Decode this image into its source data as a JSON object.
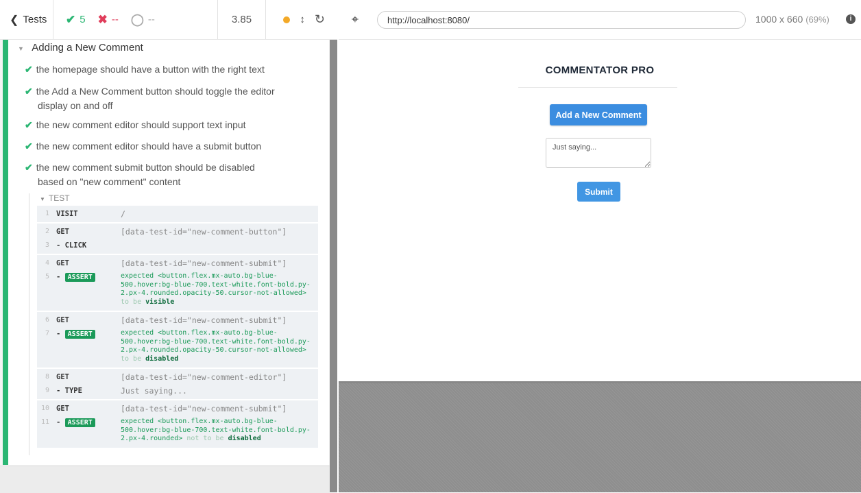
{
  "header": {
    "tests_label": "Tests",
    "passed": "5",
    "failed": "--",
    "pending": "--",
    "duration": "3.85"
  },
  "suite": {
    "title": "Adding a New Comment",
    "tests": [
      {
        "title": "the homepage should have a button with the right text"
      },
      {
        "title_line1": "the Add a New Comment button should toggle the editor",
        "title_line2": "display on and off"
      },
      {
        "title": "the new comment editor should support text input"
      },
      {
        "title": "the new comment editor should have a submit button"
      },
      {
        "title_line1": "the new comment submit button should be disabled",
        "title_line2": "based on \"new comment\" content"
      }
    ],
    "test_label": "TEST"
  },
  "commands": [
    {
      "num": "1",
      "name": "VISIT",
      "message": "/"
    },
    {
      "num": "2",
      "name": "GET",
      "message": "[data-test-id=\"new-comment-button\"]"
    },
    {
      "num": "3",
      "name": "- CLICK",
      "message": ""
    },
    {
      "num": "4",
      "name": "GET",
      "message": "[data-test-id=\"new-comment-submit\"]"
    },
    {
      "num": "5",
      "name": "ASSERT",
      "lines": [
        "expected <button.flex.mx-auto.bg-blue-",
        "500.hover:bg-blue-700.text-white.font-bold.py-",
        "2.px-4.rounded.opacity-50.cursor-not-allowed>"
      ],
      "tail": "to be",
      "target": "visible"
    },
    {
      "num": "6",
      "name": "GET",
      "message": "[data-test-id=\"new-comment-submit\"]"
    },
    {
      "num": "7",
      "name": "ASSERT",
      "lines": [
        "expected <button.flex.mx-auto.bg-blue-",
        "500.hover:bg-blue-700.text-white.font-bold.py-",
        "2.px-4.rounded.opacity-50.cursor-not-allowed>"
      ],
      "tail": "to be",
      "target": "disabled"
    },
    {
      "num": "8",
      "name": "GET",
      "message": "[data-test-id=\"new-comment-editor\"]"
    },
    {
      "num": "9",
      "name": "- TYPE",
      "message": "Just saying..."
    },
    {
      "num": "10",
      "name": "GET",
      "message": "[data-test-id=\"new-comment-submit\"]"
    },
    {
      "num": "11",
      "name": "ASSERT",
      "lines": [
        "expected <button.flex.mx-auto.bg-blue-",
        "500.hover:bg-blue-700.text-white.font-bold.py-"
      ],
      "last_line": "2.px-4.rounded>",
      "tail": "not to be",
      "target": "disabled"
    }
  ],
  "aut": {
    "url": "http://localhost:8080/",
    "viewport": "1000 x 660",
    "scale": "(69%)",
    "app_title": "COMMENTATOR PRO",
    "add_button": "Add a New Comment",
    "editor_value": "Just saying...",
    "submit_button": "Submit"
  },
  "colors": {
    "pass": "#2bb673",
    "fail": "#e03d5b",
    "primary_button": "#3b8de0",
    "assert_badge": "#1b9a59"
  }
}
